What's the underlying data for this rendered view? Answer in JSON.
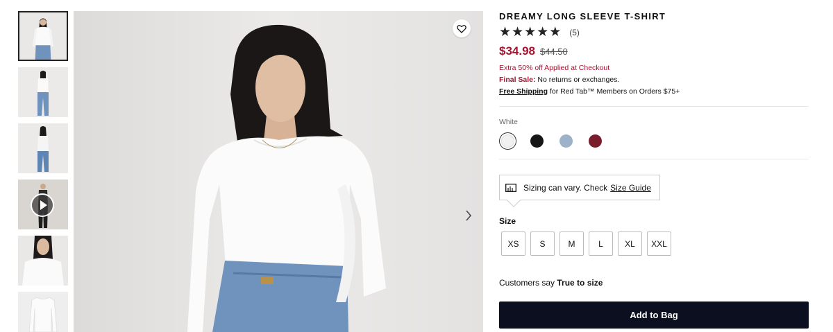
{
  "product": {
    "title": "DREAMY LONG SLEEVE T-SHIRT",
    "rating": {
      "stars_filled": 5,
      "stars_total": 5,
      "review_count": "(5)"
    },
    "price": {
      "sale": "$34.98",
      "original": "$44.50"
    },
    "promo": "Extra 50% off Applied at Checkout",
    "final_sale": {
      "label": "Final Sale:",
      "text": " No returns or exchanges."
    },
    "shipping": {
      "link": "Free Shipping",
      "text": " for Red Tab™ Members on Orders $75+"
    }
  },
  "colors": {
    "selected_label": "White",
    "swatches": [
      {
        "name": "White",
        "hex": "#f1f1f1"
      },
      {
        "name": "Black",
        "hex": "#161616"
      },
      {
        "name": "Light Blue",
        "hex": "#9cb2c8"
      },
      {
        "name": "Burgundy",
        "hex": "#7a1d2c"
      }
    ]
  },
  "sizing": {
    "tip_text": "Sizing can vary. Check ",
    "tip_link": "Size Guide",
    "label": "Size",
    "options": [
      "XS",
      "S",
      "M",
      "L",
      "XL",
      "XXL"
    ]
  },
  "fit": {
    "prefix": "Customers say ",
    "value": "True to size"
  },
  "actions": {
    "add_to_bag": "Add to Bag"
  },
  "icons": {
    "wishlist": "heart-icon",
    "next": "chevron-right-icon",
    "play": "play-icon",
    "ruler": "ruler-icon",
    "star": "star-icon"
  },
  "accent": {
    "sale_red": "#a7132f",
    "button_navy": "#0c0f1f"
  }
}
